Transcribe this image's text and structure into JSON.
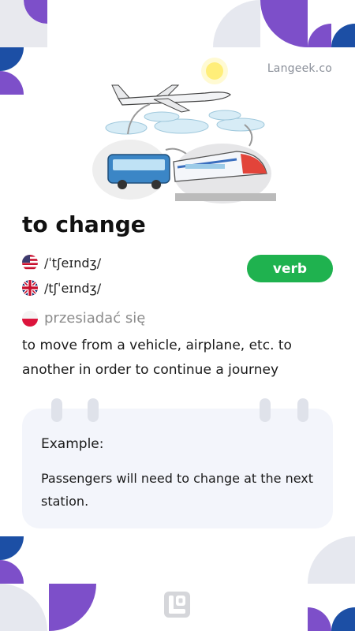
{
  "brand": {
    "site": "Langeek.co"
  },
  "word": {
    "title": "to change"
  },
  "pronunciations": [
    {
      "region": "us-flag-icon",
      "ipa": "/ˈtʃeɪndʒ/"
    },
    {
      "region": "uk-flag-icon",
      "ipa": "/tʃˈeɪndʒ/"
    }
  ],
  "part_of_speech": "verb",
  "translation": {
    "flag": "poland-flag-icon",
    "text": "przesiadać się"
  },
  "definition": "to move from a vehicle, airplane, etc. to another in order to continue a journey",
  "example": {
    "label": "Example:",
    "sentence": "Passengers will need to change at the next station."
  },
  "colors": {
    "purple": "#7d4fc9",
    "blue": "#1c4fa5",
    "light_gray": "#e6e8ef",
    "green_badge": "#1fb24f",
    "card_bg": "#f3f5fb"
  }
}
